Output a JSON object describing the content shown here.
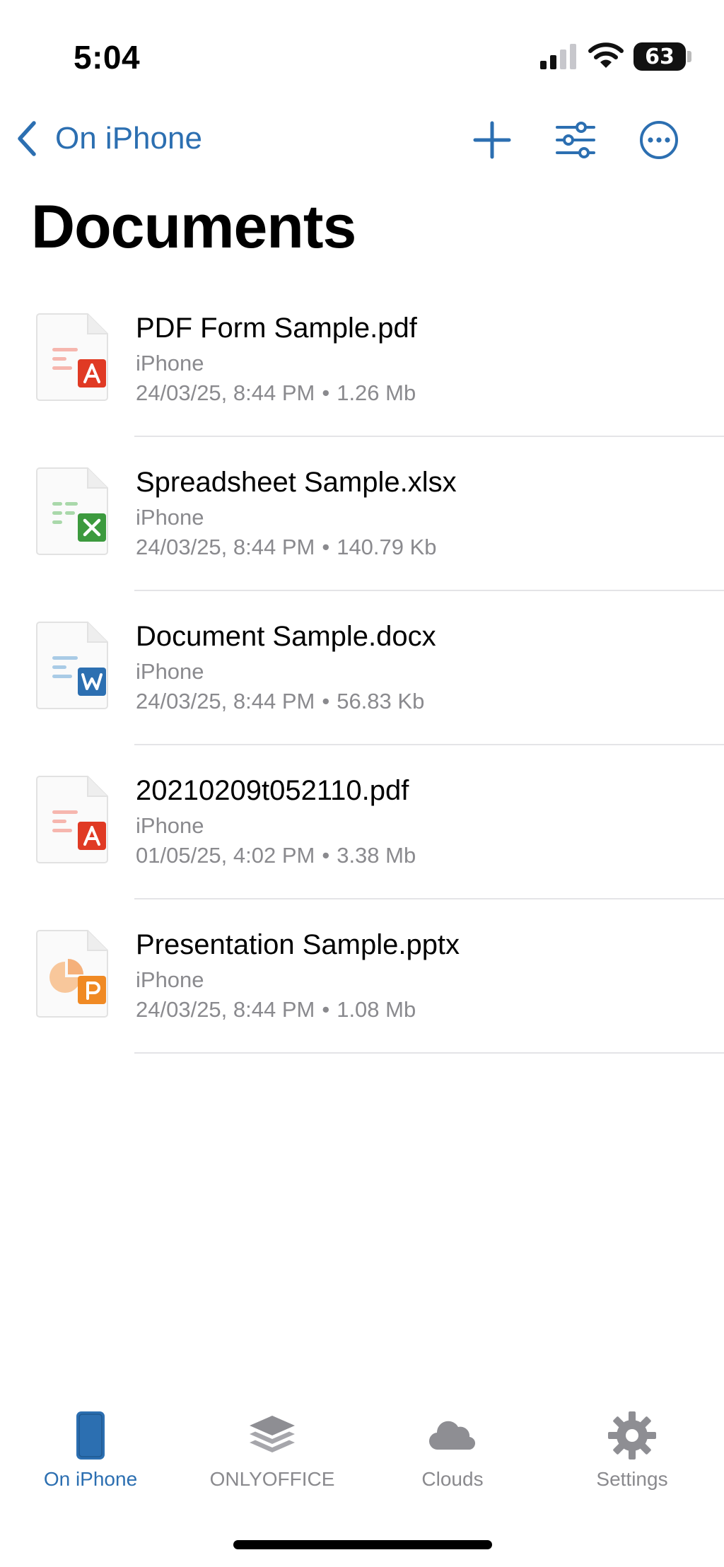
{
  "status_bar": {
    "time": "5:04",
    "battery_level": "63"
  },
  "nav": {
    "back_label": "On iPhone",
    "title": "Documents"
  },
  "colors": {
    "accent": "#2c6fb1",
    "secondary_text": "#8a8a8e",
    "pdf": "#e03a24",
    "xlsx": "#3c9a3e",
    "docx": "#2c6fb1",
    "pptx": "#f08a24"
  },
  "files": [
    {
      "name": "PDF Form Sample.pdf",
      "location": "iPhone",
      "date": "24/03/25, 8:44 PM",
      "separator": "•",
      "size": "1.26 Mb",
      "type": "pdf",
      "icon": "pdf-file-icon"
    },
    {
      "name": "Spreadsheet Sample.xlsx",
      "location": "iPhone",
      "date": "24/03/25, 8:44 PM",
      "separator": "•",
      "size": "140.79 Kb",
      "type": "xlsx",
      "icon": "spreadsheet-file-icon"
    },
    {
      "name": "Document Sample.docx",
      "location": "iPhone",
      "date": "24/03/25, 8:44 PM",
      "separator": "•",
      "size": "56.83 Kb",
      "type": "docx",
      "icon": "document-file-icon"
    },
    {
      "name": "20210209t052110.pdf",
      "location": "iPhone",
      "date": "01/05/25, 4:02 PM",
      "separator": "•",
      "size": "3.38 Mb",
      "type": "pdf",
      "icon": "pdf-file-icon"
    },
    {
      "name": "Presentation Sample.pptx",
      "location": "iPhone",
      "date": "24/03/25, 8:44 PM",
      "separator": "•",
      "size": "1.08 Mb",
      "type": "pptx",
      "icon": "presentation-file-icon"
    }
  ],
  "tabs": [
    {
      "label": "On iPhone",
      "icon": "phone-icon",
      "active": true
    },
    {
      "label": "ONLYOFFICE",
      "icon": "layers-icon",
      "active": false
    },
    {
      "label": "Clouds",
      "icon": "cloud-icon",
      "active": false
    },
    {
      "label": "Settings",
      "icon": "gear-icon",
      "active": false
    }
  ]
}
